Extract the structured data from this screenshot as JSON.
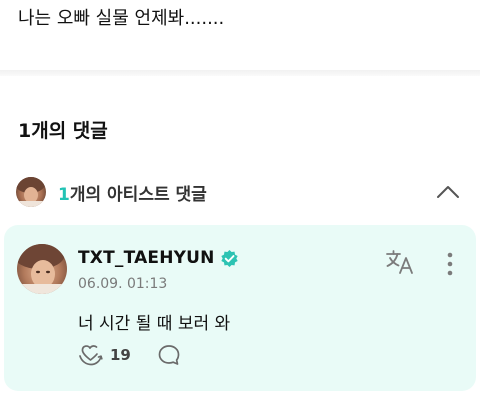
{
  "post": {
    "text": "나는 오빠 실물 언제봐......."
  },
  "comments_section": {
    "heading": "1개의 댓글"
  },
  "artist_comments_bar": {
    "count": "1",
    "label_suffix": "개의 아티스트 댓글",
    "toggle_icon": "chevron-up-icon"
  },
  "comment": {
    "author": "TXT_TAEHYUN",
    "verified_icon": "verified-badge-icon",
    "timestamp": "06.09. 01:13",
    "body": "너 시간 될 때 보러 와",
    "like_count": "19",
    "translate_icon": "translate-icon",
    "more_icon": "more-vertical-icon",
    "like_icon": "like-icon",
    "reply_icon": "reply-bubble-icon"
  },
  "colors": {
    "accent": "#22c3b5",
    "card_background": "#e9fbf7",
    "verified_badge": "#2dc3b3"
  }
}
